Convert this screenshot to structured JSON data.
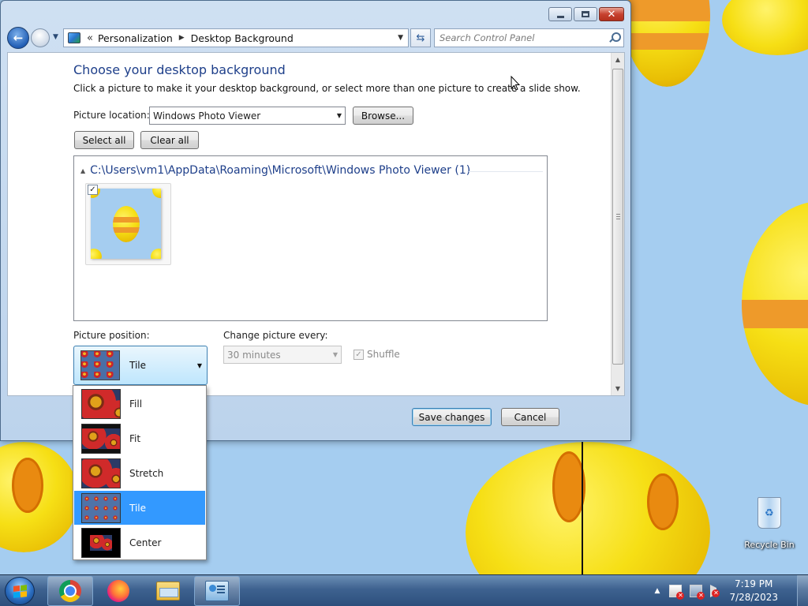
{
  "window": {
    "breadcrumb": [
      "Personalization",
      "Desktop Background"
    ],
    "search_placeholder": "Search Control Panel"
  },
  "page": {
    "title": "Choose your desktop background",
    "description": "Click a picture to make it your desktop background, or select more than one picture to create a slide show.",
    "picture_location_label": "Picture location:",
    "picture_location_value": "Windows Photo Viewer",
    "browse_label": "Browse...",
    "select_all_label": "Select all",
    "clear_all_label": "Clear all",
    "group_path": "C:\\Users\\vm1\\AppData\\Roaming\\Microsoft\\Windows Photo Viewer (1)",
    "picture_checked": true,
    "picture_position_label": "Picture position:",
    "picture_position_value": "Tile",
    "change_picture_label": "Change picture every:",
    "change_picture_value": "30 minutes",
    "shuffle_label": "Shuffle",
    "shuffle_checked": true,
    "save_label": "Save changes",
    "cancel_label": "Cancel"
  },
  "position_options": [
    {
      "label": "Fill",
      "selected": false
    },
    {
      "label": "Fit",
      "selected": false
    },
    {
      "label": "Stretch",
      "selected": false
    },
    {
      "label": "Tile",
      "selected": true
    },
    {
      "label": "Center",
      "selected": false
    }
  ],
  "desktop": {
    "recycle_bin_label": "Recycle Bin"
  },
  "taskbar": {
    "apps": [
      "chrome-icon",
      "firefox-icon",
      "windows-explorer-icon",
      "control-panel-icon"
    ],
    "active_app": "control-panel-icon",
    "clock_time": "7:19 PM",
    "clock_date": "7/28/2023"
  },
  "colors": {
    "accent_title": "#1e3f8a",
    "selection": "#3399ff",
    "wallpaper": "#a5cdf0"
  }
}
